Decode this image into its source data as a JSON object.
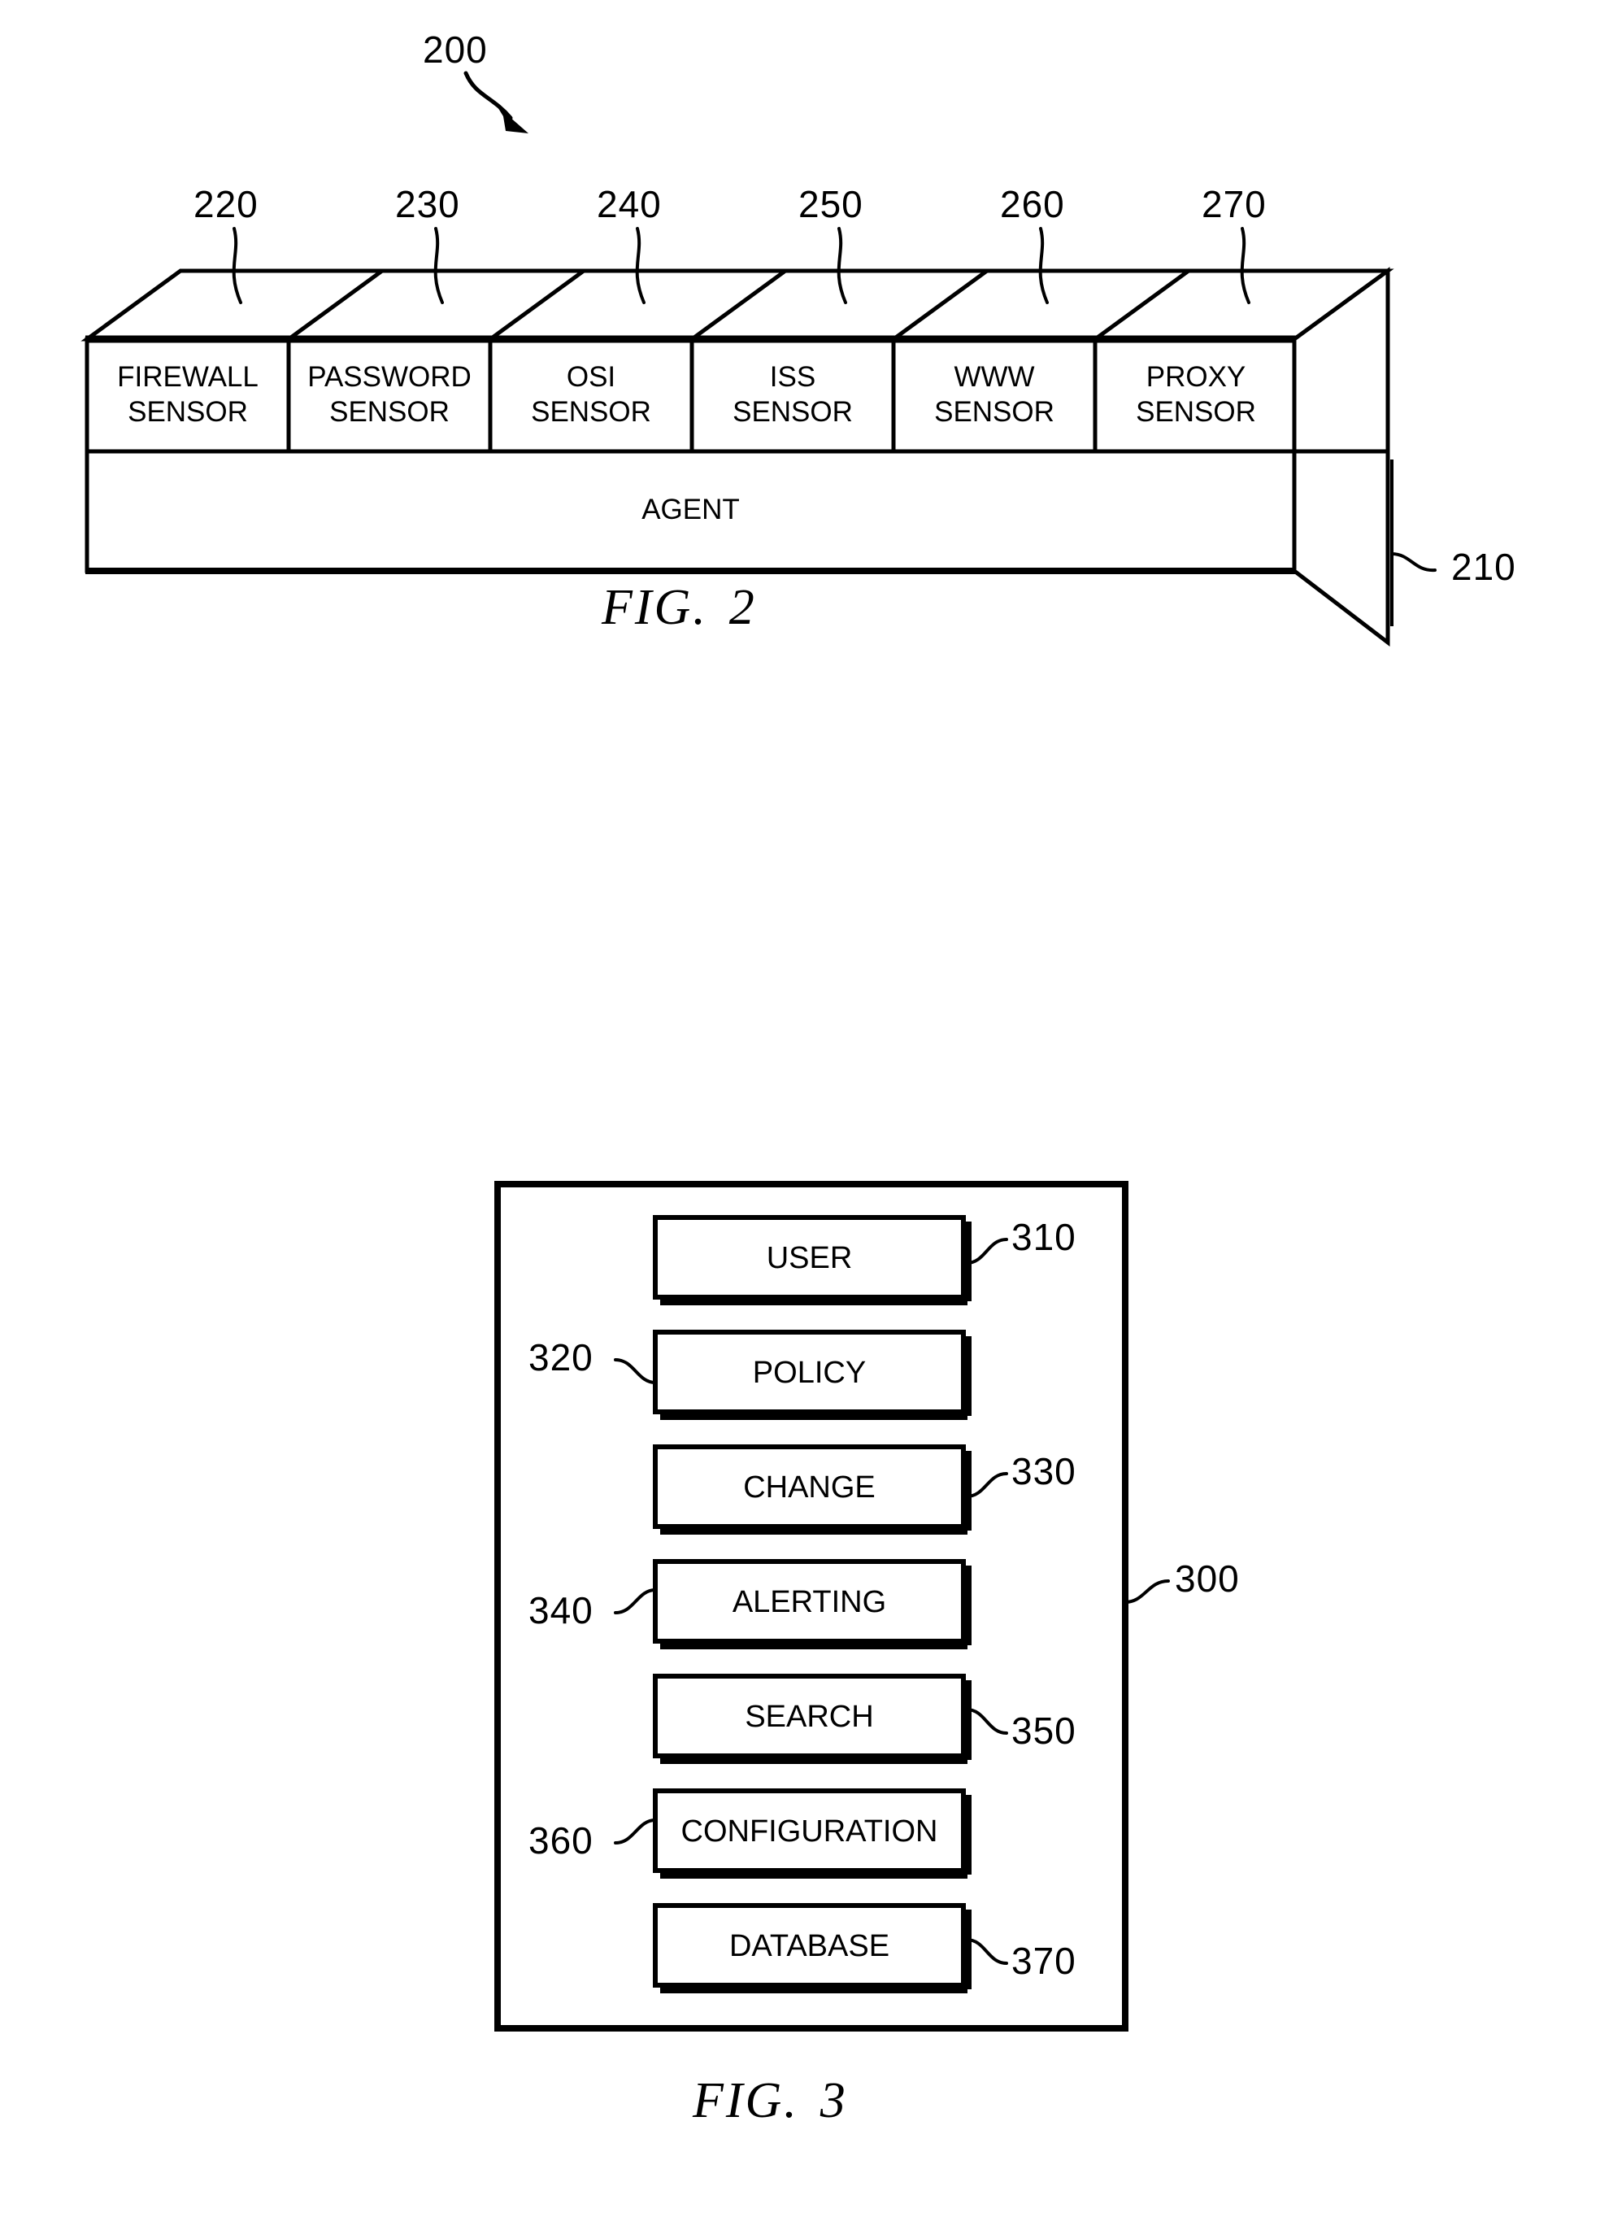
{
  "page": {
    "background": "#ffffff",
    "ink": "#000000"
  },
  "figure2": {
    "caption_prefix": "FIG.",
    "caption_number": "2",
    "assembly_ref": "200",
    "base_ref": "210",
    "base_label": "AGENT",
    "sensors": [
      {
        "ref": "220",
        "line1": "FIREWALL",
        "line2": "SENSOR"
      },
      {
        "ref": "230",
        "line1": "PASSWORD",
        "line2": "SENSOR"
      },
      {
        "ref": "240",
        "line1": "OSI",
        "line2": "SENSOR"
      },
      {
        "ref": "250",
        "line1": "ISS",
        "line2": "SENSOR"
      },
      {
        "ref": "260",
        "line1": "WWW",
        "line2": "SENSOR"
      },
      {
        "ref": "270",
        "line1": "PROXY",
        "line2": "SENSOR"
      }
    ]
  },
  "figure3": {
    "caption_prefix": "FIG.",
    "caption_number": "3",
    "container_ref": "300",
    "modules": [
      {
        "ref": "310",
        "label": "USER",
        "ref_side": "right"
      },
      {
        "ref": "320",
        "label": "POLICY",
        "ref_side": "left"
      },
      {
        "ref": "330",
        "label": "CHANGE",
        "ref_side": "right"
      },
      {
        "ref": "340",
        "label": "ALERTING",
        "ref_side": "left"
      },
      {
        "ref": "350",
        "label": "SEARCH",
        "ref_side": "right"
      },
      {
        "ref": "360",
        "label": "CONFIGURATION",
        "ref_side": "left"
      },
      {
        "ref": "370",
        "label": "DATABASE",
        "ref_side": "right"
      }
    ]
  }
}
